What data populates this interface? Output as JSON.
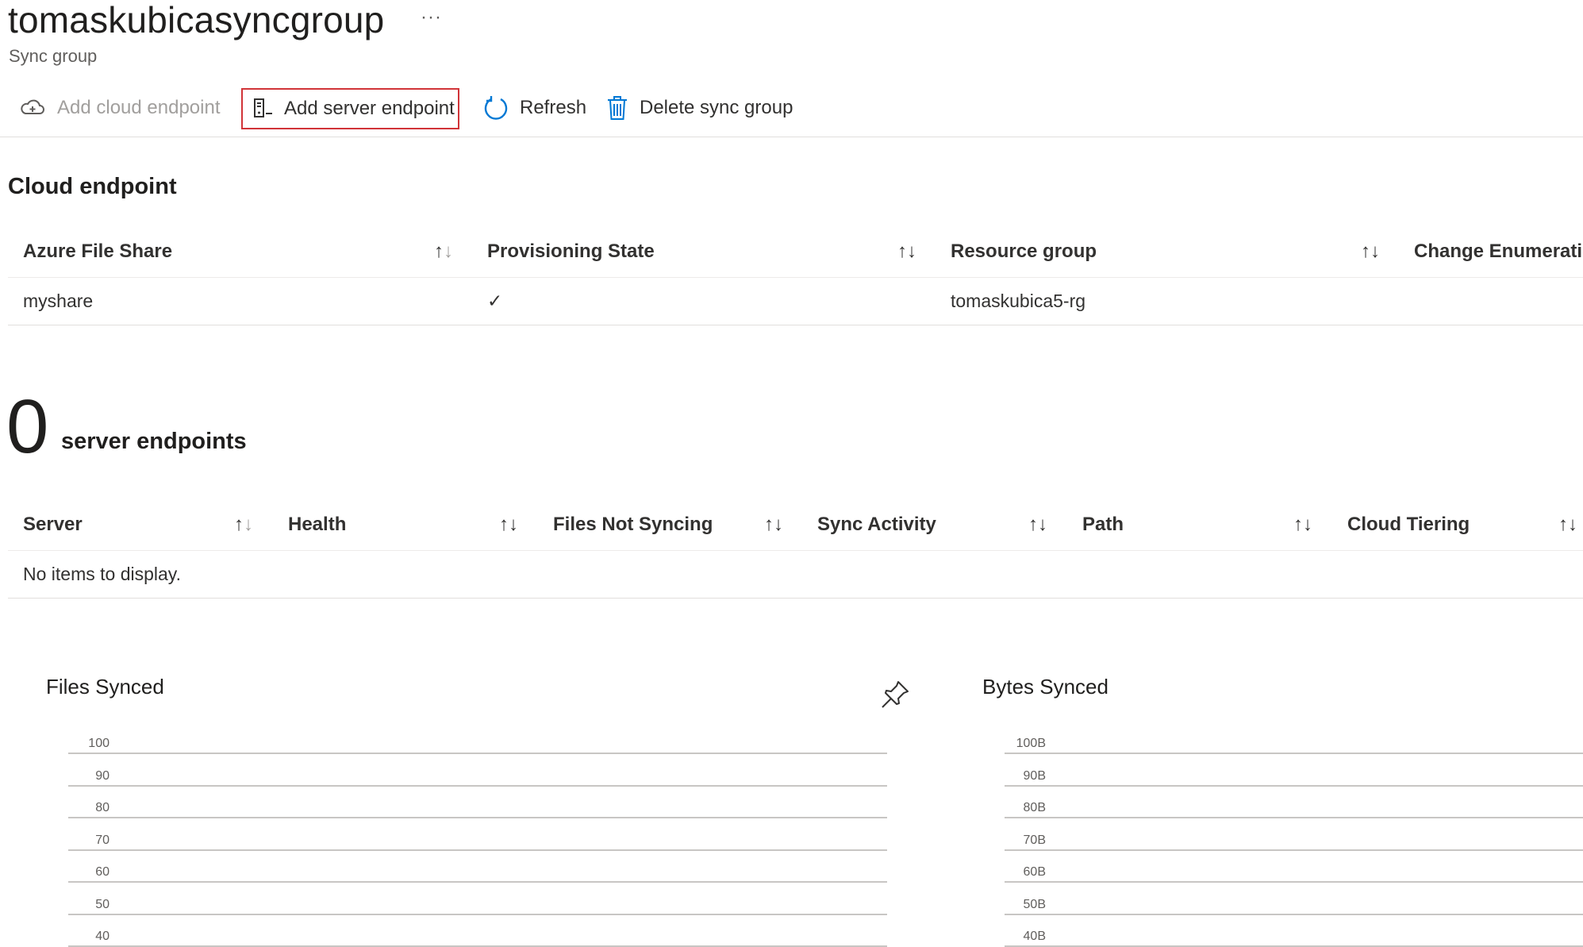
{
  "header": {
    "title": "tomaskubicasyncgroup",
    "more_label": "···",
    "subtitle": "Sync group"
  },
  "toolbar": {
    "add_cloud_endpoint": "Add cloud endpoint",
    "add_server_endpoint": "Add server endpoint",
    "refresh": "Refresh",
    "delete_sync_group": "Delete sync group"
  },
  "cloud_endpoint": {
    "heading": "Cloud endpoint",
    "columns": [
      "Azure File Share",
      "Provisioning State",
      "Resource group",
      "Change Enumeratic"
    ],
    "rows": [
      {
        "azure_file_share": "myshare",
        "provisioning_state": "✓",
        "resource_group": "tomaskubica5-rg"
      }
    ]
  },
  "server_endpoints": {
    "count": "0",
    "label": "server endpoints",
    "columns": [
      "Server",
      "Health",
      "Files Not Syncing",
      "Sync Activity",
      "Path",
      "Cloud Tiering"
    ],
    "empty_text": "No items to display."
  },
  "charts": {
    "files_synced": {
      "title": "Files Synced",
      "pin_icon": "pin-icon"
    },
    "bytes_synced": {
      "title": "Bytes Synced"
    }
  },
  "chart_data": [
    {
      "type": "line",
      "title": "Files Synced",
      "xlabel": "",
      "ylabel": "",
      "ylim": [
        40,
        100
      ],
      "y_ticks": [
        "100",
        "90",
        "80",
        "70",
        "60",
        "50",
        "40"
      ],
      "series": [],
      "grid": true
    },
    {
      "type": "line",
      "title": "Bytes Synced",
      "xlabel": "",
      "ylabel": "",
      "ylim": [
        40,
        100
      ],
      "y_ticks": [
        "100B",
        "90B",
        "80B",
        "70B",
        "60B",
        "50B",
        "40B"
      ],
      "series": [],
      "grid": true
    }
  ],
  "icons": {
    "add_cloud": "cloud-add-icon",
    "add_server": "server-add-icon",
    "refresh": "refresh-icon",
    "delete": "trash-icon",
    "sort": "sort-icon",
    "check": "checkmark-icon",
    "pin": "pin-icon"
  },
  "colors": {
    "accent": "#0078d4",
    "highlight_border": "#d13438",
    "text": "#323130",
    "disabled": "#a19f9d"
  }
}
